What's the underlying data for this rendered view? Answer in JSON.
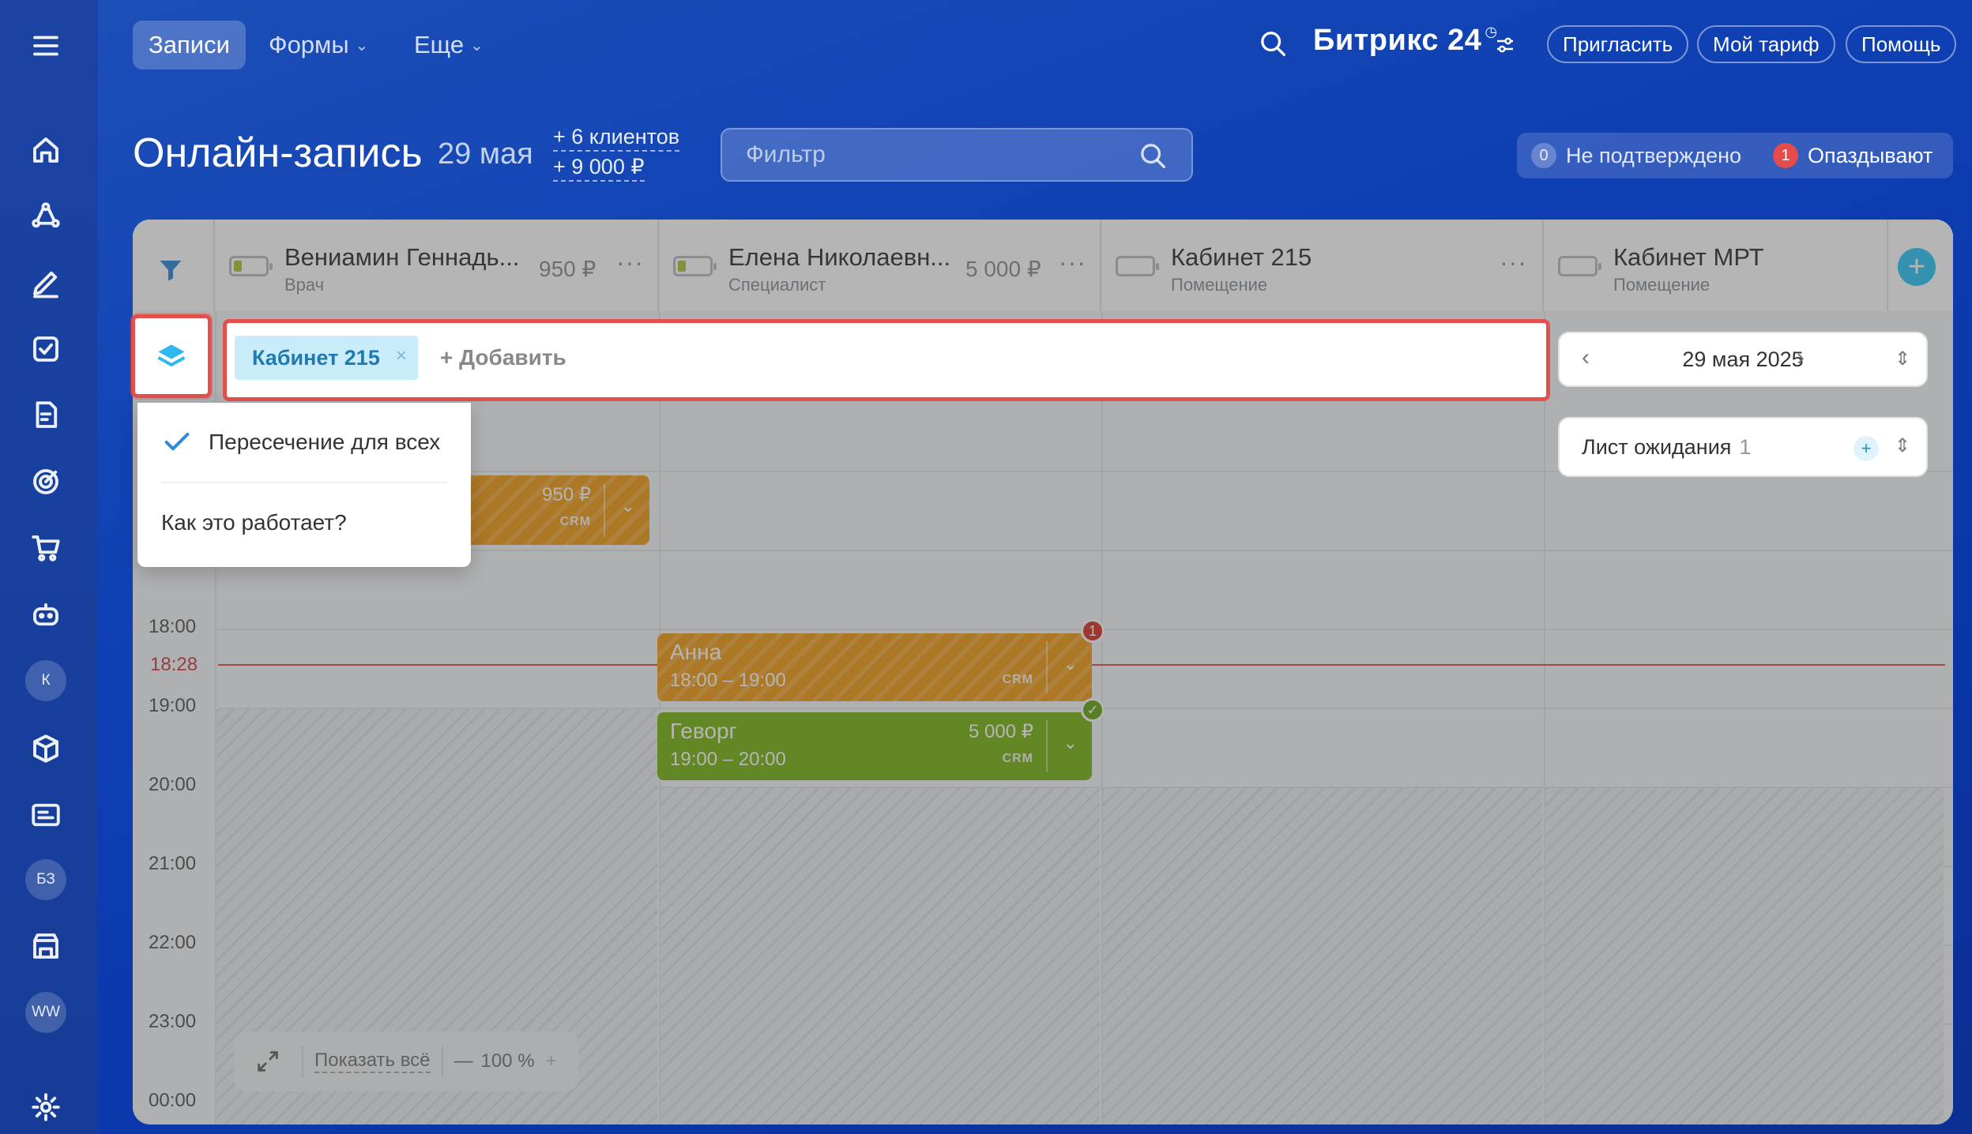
{
  "sidebar": {
    "icons": [
      "menu-icon",
      "home-icon",
      "crm-icon",
      "pen-icon",
      "tasks-icon",
      "docs-icon",
      "target-icon",
      "cart-icon",
      "robot-icon",
      "box-icon",
      "id-card-icon",
      "store-icon",
      "gear-icon"
    ],
    "avatars": [
      "К",
      "БЗ",
      "WW"
    ]
  },
  "topbar": {
    "tabs": [
      {
        "label": "Записи",
        "active": true
      },
      {
        "label": "Формы",
        "dropdown": true
      },
      {
        "label": "Еще",
        "dropdown": true
      }
    ],
    "brand": "Битрикс 24",
    "brand_mark": "◷",
    "invite": "Пригласить",
    "tariff": "Мой тариф",
    "help": "Помощь"
  },
  "header": {
    "title": "Онлайн-запись",
    "date": "29 мая",
    "clients": "+ 6 клиентов",
    "revenue": "+ 9 000 ₽",
    "filter_placeholder": "Фильтр",
    "unconfirmed_count": "0",
    "unconfirmed_label": "Не подтверждено",
    "late_count": "1",
    "late_label": "Опаздывают"
  },
  "columns": [
    {
      "name": "Вениамин Геннадь...",
      "role": "Врач",
      "price": "950 ₽"
    },
    {
      "name": "Елена Николаевн...",
      "role": "Специалист",
      "price": "5 000 ₽"
    },
    {
      "name": "Кабинет 215",
      "role": "Помещение",
      "price": ""
    },
    {
      "name": "Кабинет МРТ",
      "role": "Помещение",
      "price": ""
    }
  ],
  "times": [
    "18:00",
    "19:00",
    "20:00",
    "21:00",
    "22:00",
    "23:00",
    "00:00"
  ],
  "now_time": "18:28",
  "bookings": [
    {
      "name": "",
      "time": "",
      "price": "950 ₽",
      "icons": "CRM",
      "color": "#f29d17"
    },
    {
      "name": "Анна",
      "time": "18:00 – 19:00",
      "price": "",
      "icons": "CRM",
      "badge": "1",
      "color": "#f29d17"
    },
    {
      "name": "Геворг",
      "time": "19:00 – 20:00",
      "price": "5 000 ₽",
      "icons": "CRM",
      "badge": "✓",
      "color": "#7cb518"
    }
  ],
  "right_panel": {
    "date": "29 мая 2025",
    "waitlist_label": "Лист ожидания",
    "waitlist_count": "1"
  },
  "zoom": {
    "show_all": "Показать всё",
    "level": "100 %",
    "minus": "—",
    "plus": "+"
  },
  "resource_filter": {
    "tag": "Кабинет 215",
    "add_label": "+ Добавить"
  },
  "popup": {
    "option_checked": "Пересечение для всех",
    "how_it_works": "Как это работает?"
  }
}
